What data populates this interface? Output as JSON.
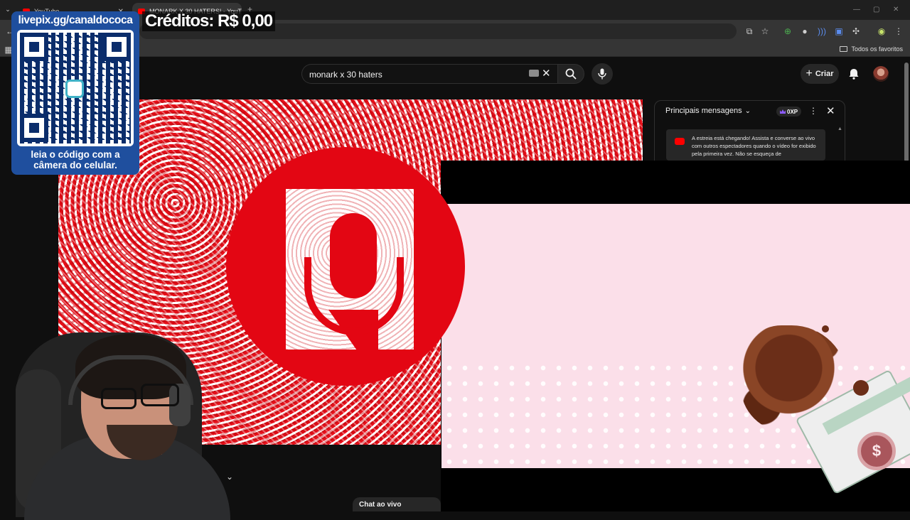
{
  "browser": {
    "tabs": [
      {
        "title": "YouTube",
        "active": false
      },
      {
        "title": "MONARK X 30 HATERS! - YouTu...",
        "active": true
      }
    ],
    "new_tab_label": "+",
    "address": "Hidden/partially obscured URL",
    "bookmarks_folder": "Todos os favoritos"
  },
  "youtube": {
    "search_value": "monark x 30 haters",
    "create_label": "Criar",
    "chat": {
      "title": "Principais mensagens",
      "xp_badge": "0XP",
      "premiere_message": "A estreia está chegando! Assista e converse ao vivo com outros espectadores quando o vídeo for exibido pela primeira vez. Não se esqueça de"
    },
    "live_chat_button": "Chat ao vivo"
  },
  "stream_overlay": {
    "livepix_url": "livepix.gg/canaldococa",
    "qr_caption_line1": "leia o código com a",
    "qr_caption_line2": "câmera do celular.",
    "credits": "Créditos: R$ 0,00",
    "coin_symbol": "$"
  },
  "colors": {
    "youtube_red": "#ff0000",
    "logo_red": "#e30613",
    "livepix_blue": "#1f4f9e",
    "overlay_pink": "#fbdfe9"
  }
}
